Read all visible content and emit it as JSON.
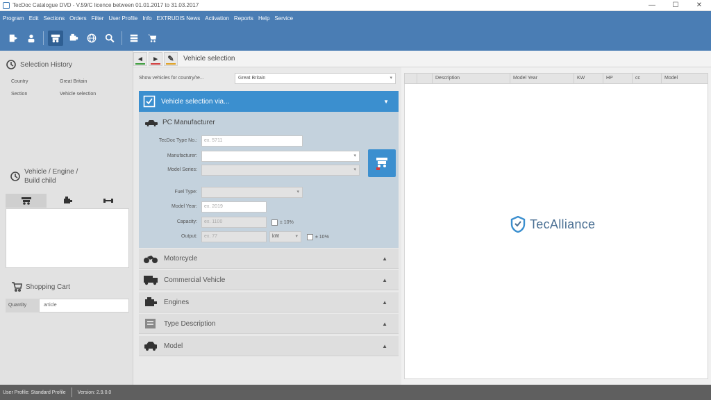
{
  "window": {
    "title": "TecDoc Catalogue DVD - V.59/C licence between 01.01.2017 to 31.03.2017",
    "controls": [
      "—",
      "☐",
      "✕"
    ]
  },
  "menu": [
    "Program",
    "Edit",
    "Sections",
    "Orders",
    "Filter",
    "User Profile",
    "Info",
    "EXTRUDIS News",
    "Activation",
    "Reports",
    "Help",
    "Service"
  ],
  "toolbar_icons": [
    "exit-icon",
    "user-icon",
    "vehicle-search-icon",
    "engine-icon",
    "globe-icon",
    "zoom-icon",
    "list-icon",
    "cart-icon"
  ],
  "left": {
    "history_title": "Selection History",
    "history_rows": [
      {
        "key": "Country",
        "value": "Great Britain"
      },
      {
        "key": "Section",
        "value": "Vehicle selection"
      }
    ],
    "vehicle_title_1": "Vehicle / Engine /",
    "vehicle_title_2": "Build child",
    "cart_title": "Shopping Cart",
    "cart_qty_label": "Quantity",
    "cart_article_value": "article"
  },
  "header": {
    "back": "◂",
    "forward": "▸",
    "edit": "✎",
    "breadcrumb": "Vehicle selection"
  },
  "middle": {
    "country_label": "Show vehicles for country/re...",
    "country_value": "Great Britain",
    "accordion_title": "Vehicle selection via...",
    "pc_title": "PC Manufacturer",
    "fields": {
      "type_no_label": "TecDoc Type No.:",
      "type_no_placeholder": "ex. 5711",
      "manufacturer_label": "Manufacturer:",
      "model_series_label": "Model Series:",
      "fuel_type_label": "Fuel Type:",
      "model_year_label": "Model Year:",
      "model_year_placeholder": "ex. 2019",
      "capacity_label": "Capacity:",
      "capacity_placeholder": "ex. 1100",
      "output_label": "Output:",
      "output_placeholder": "ex. 77",
      "output_unit": "kW",
      "capacity_tol": "± 10%",
      "output_tol": "± 10%"
    },
    "collapsed": [
      {
        "label": "Motorcycle",
        "icon": "motorcycle-icon"
      },
      {
        "label": "Commercial Vehicle",
        "icon": "truck-icon"
      },
      {
        "label": "Engines",
        "icon": "engine-icon"
      },
      {
        "label": "Type Description",
        "icon": "type-description-icon"
      },
      {
        "label": "Model",
        "icon": "car-model-icon"
      }
    ]
  },
  "right": {
    "columns": [
      "",
      "",
      "Description",
      "Model Year",
      "KW",
      "HP",
      "cc",
      "Model"
    ],
    "logo_text": "TecAlliance"
  },
  "status": {
    "profile": "User Profile: Standard Profile",
    "version": "Version: 2.9.0.0"
  },
  "colors": {
    "menubar": "#4a7db4",
    "accent": "#3b8fcf",
    "panel_body": "#c4d2dd",
    "statusbar": "#5f5f5f"
  }
}
